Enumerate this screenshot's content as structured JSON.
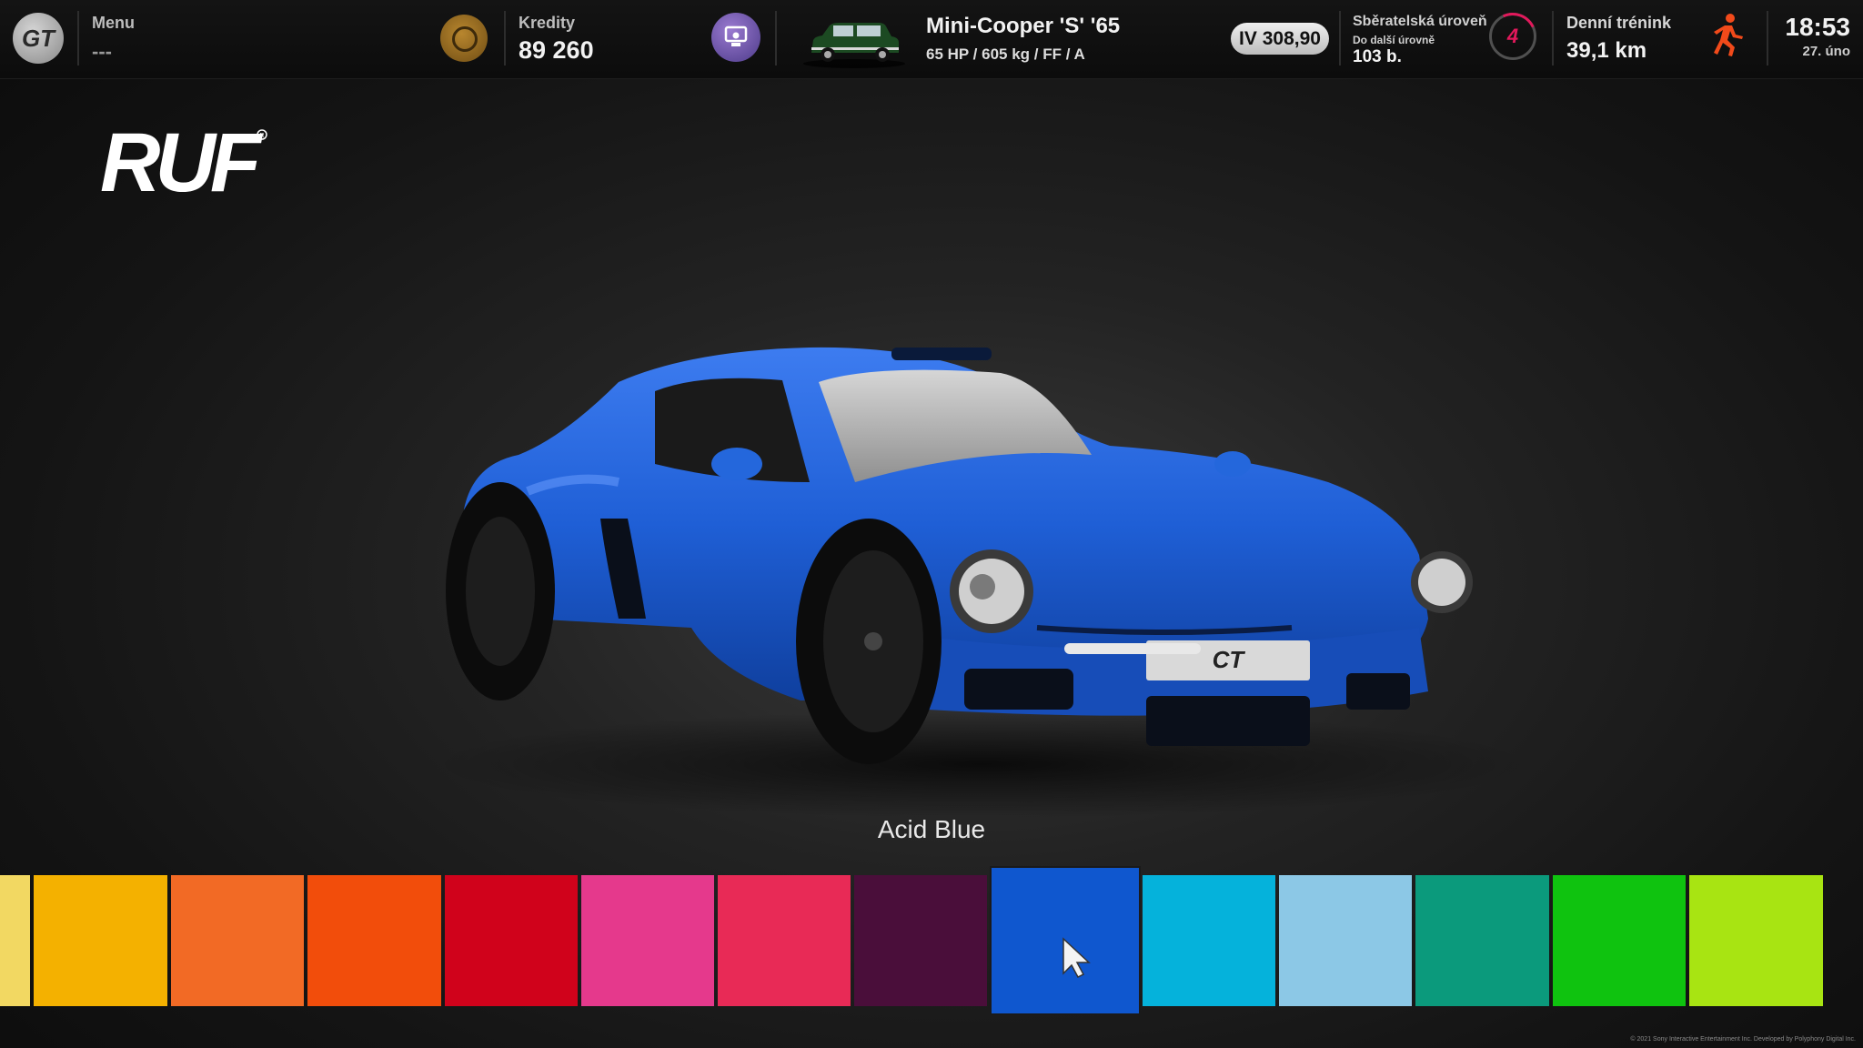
{
  "topbar": {
    "menu_label": "Menu",
    "menu_value": "---",
    "credits_label": "Kredity",
    "credits_value": "89 260",
    "car_name": "Mini-Cooper 'S' '65",
    "car_specs": "65 HP / 605 kg / FF / A",
    "pp_rating": "IV 308,90",
    "collector_label": "Sběratelská úroveň",
    "next_level_label": "Do další úrovně",
    "next_level_points": "103 b.",
    "collector_level": "4",
    "daily_label": "Denní trénink",
    "daily_distance": "39,1 km",
    "time": "18:53",
    "date": "27. úno"
  },
  "brand": {
    "name": "RUF"
  },
  "color_picker": {
    "selected_name": "Acid Blue",
    "swatches": [
      {
        "color": "#f2d862"
      },
      {
        "color": "#f4b100"
      },
      {
        "color": "#f26a25"
      },
      {
        "color": "#f24d0b"
      },
      {
        "color": "#d0021b"
      },
      {
        "color": "#e5398c"
      },
      {
        "color": "#e82a56"
      },
      {
        "color": "#4a0e3a"
      },
      {
        "color": "#0f57cf",
        "selected": true
      },
      {
        "color": "#05b2db"
      },
      {
        "color": "#8cc8e6"
      },
      {
        "color": "#0b9a7c"
      },
      {
        "color": "#0fc30f"
      },
      {
        "color": "#a8e412"
      }
    ]
  },
  "car": {
    "paint_color": "#1f5fd6"
  },
  "footer": {
    "copyright": "© 2021 Sony Interactive Entertainment Inc. Developed by Polyphony Digital Inc."
  }
}
